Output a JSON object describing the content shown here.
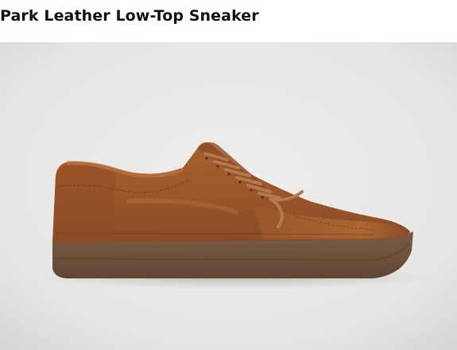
{
  "product": {
    "title": "Park Leather Low-Top Sneaker",
    "image_subject": "shoe",
    "image_alt": "Park Leather Low-Top Sneaker"
  },
  "colors": {
    "backdrop": "#e9e8e6",
    "upper": "#a05a2e",
    "sole": "#6e533e",
    "laces": "#b07a4d"
  }
}
